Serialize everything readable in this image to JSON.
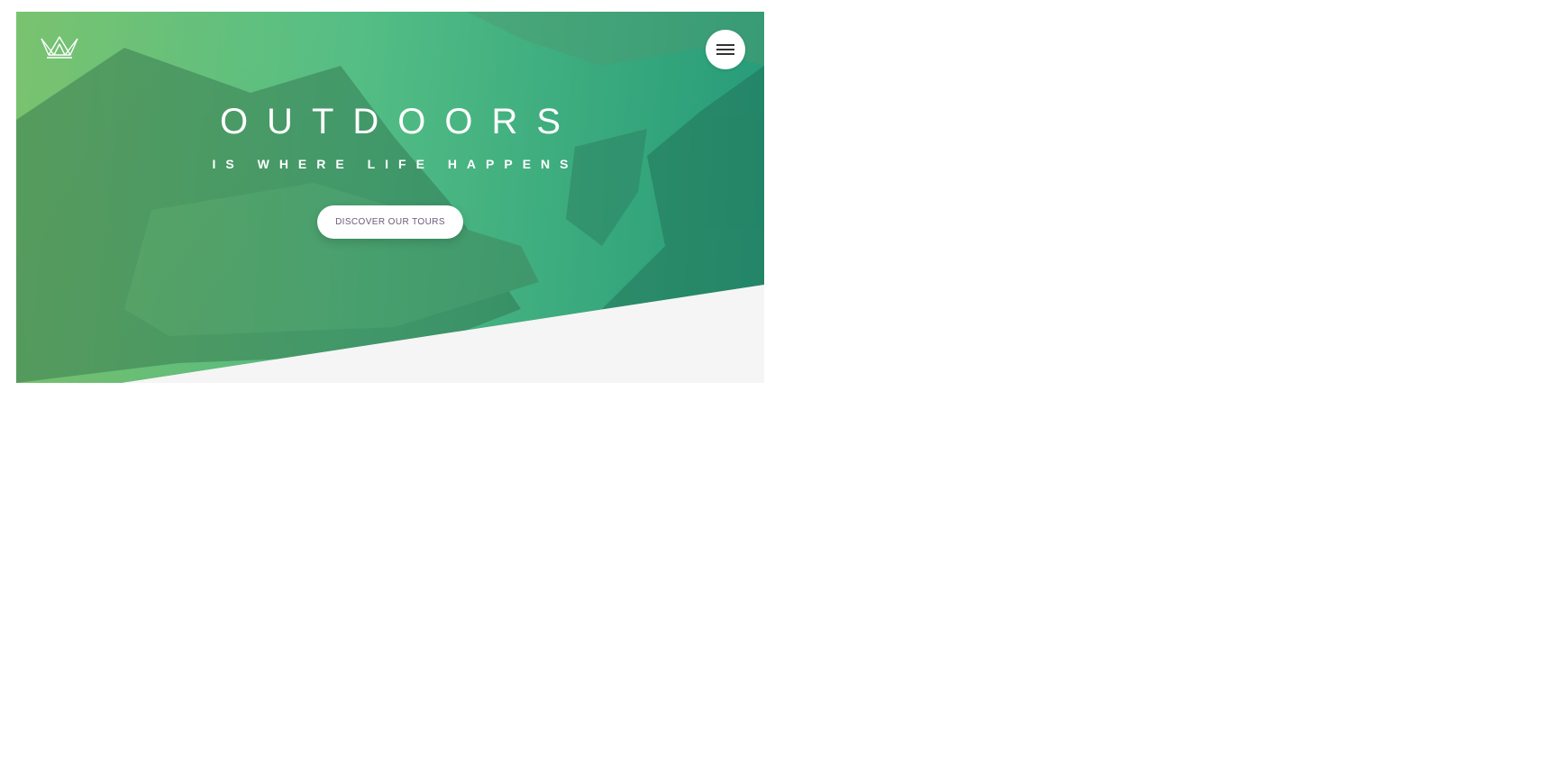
{
  "hero": {
    "title": "OUTDOORS",
    "subtitle": "IS WHERE LIFE HAPPENS",
    "cta_label": "DISCOVER OUR TOURS"
  },
  "header": {
    "logo_icon": "crown-icon",
    "menu_icon": "hamburger-menu-icon"
  },
  "colors": {
    "gradient_start": "#7ec770",
    "gradient_mid": "#56c48a",
    "gradient_end": "#269e7c",
    "background": "#f5f5f5",
    "button_text": "#6a5a78"
  }
}
